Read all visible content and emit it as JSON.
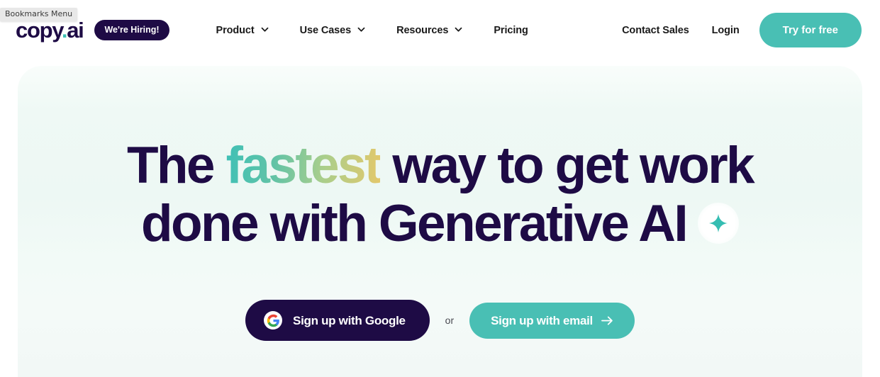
{
  "browser_overlay": {
    "tooltip": "Bookmarks Menu"
  },
  "header": {
    "logo": {
      "text_before_dot": "copy",
      "dot": ".",
      "text_after_dot": "ai",
      "full": "copy.ai"
    },
    "hiring_badge": "We're Hiring!",
    "nav": [
      {
        "label": "Product",
        "has_dropdown": true,
        "icon": "chevron-down-icon"
      },
      {
        "label": "Use Cases",
        "has_dropdown": true,
        "icon": "chevron-down-icon"
      },
      {
        "label": "Resources",
        "has_dropdown": true,
        "icon": "chevron-down-icon"
      },
      {
        "label": "Pricing",
        "has_dropdown": false,
        "icon": ""
      }
    ],
    "contact_sales": "Contact Sales",
    "login": "Login",
    "try_for_free": "Try for free"
  },
  "hero": {
    "headline": {
      "line1_part1": "The ",
      "line1_highlight": "fastest",
      "line1_part2": " way to get work",
      "line2": "done with Generative AI",
      "sparkle_icon": "sparkle-icon"
    },
    "cta": {
      "google_button": "Sign up with Google",
      "google_icon": "google-g-icon",
      "or": "or",
      "email_button": "Sign up with email",
      "email_arrow_icon": "arrow-right-icon"
    }
  },
  "colors": {
    "brand_dark": "#1E0B45",
    "brand_teal": "#49BFB4",
    "gradient_start": "#3FC0B6",
    "gradient_mid": "#A8CE8C",
    "gradient_end": "#E4C86B",
    "hero_bg": "#EDF8F4",
    "page_bg": "#FFFFFF",
    "nav_text": "#1A1A1A"
  }
}
